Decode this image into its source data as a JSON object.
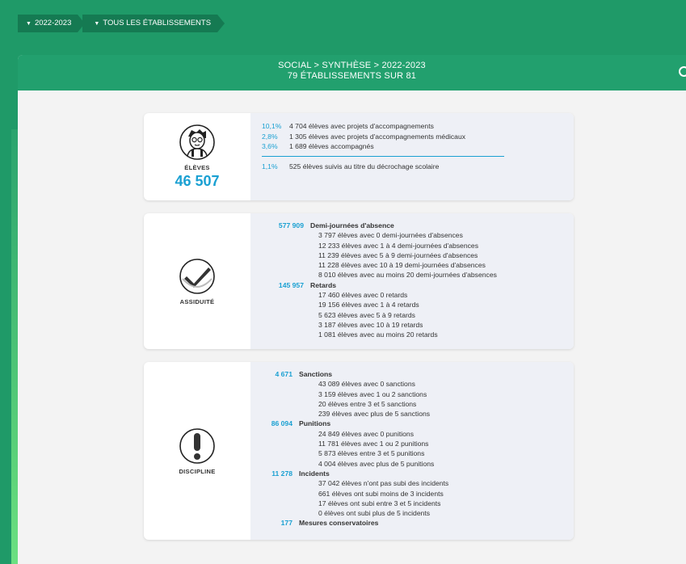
{
  "filters": {
    "year_label": "2022-2023",
    "establishments_label": "TOUS LES ÉTABLISSEMENTS"
  },
  "panel": {
    "title_line1": "SOCIAL > SYNTHÈSE > 2022-2023",
    "title_line2": "79 ÉTABLISSEMENTS SUR 81"
  },
  "eleves": {
    "label": "ÉLÈVES",
    "total": "46 507",
    "rows": [
      {
        "pct": "10,1%",
        "text": "4 704 élèves avec projets d'accompagnements"
      },
      {
        "pct": "2,8%",
        "text": "1 305 élèves avec projets d'accompagnements médicaux"
      },
      {
        "pct": "3,6%",
        "text": "1 689 élèves accompagnés"
      }
    ],
    "row_after": {
      "pct": "1,1%",
      "text": "525 élèves suivis au titre du décrochage scolaire"
    }
  },
  "assiduite": {
    "label": "ASSIDUITÉ",
    "sections": [
      {
        "num": "577 909",
        "title": "Demi-journées d'absence",
        "items": [
          "3 797 élèves avec 0 demi-journées d'absences",
          "12 233 élèves avec 1 à 4 demi-journées d'absences",
          "11 239 élèves avec 5 à 9 demi-journées d'absences",
          "11 228 élèves avec 10 à 19 demi-journées d'absences",
          "8 010 élèves avec au moins 20 demi-journées d'absences"
        ]
      },
      {
        "num": "145 957",
        "title": "Retards",
        "items": [
          "17 460 élèves avec 0 retards",
          "19 156 élèves avec 1 à 4 retards",
          "5 623 élèves avec 5 à 9 retards",
          "3 187 élèves avec 10 à 19 retards",
          "1 081 élèves avec au moins 20 retards"
        ]
      }
    ]
  },
  "discipline": {
    "label": "DISCIPLINE",
    "sections": [
      {
        "num": "4 671",
        "title": "Sanctions",
        "items": [
          "43 089 élèves avec 0 sanctions",
          "3 159 élèves avec 1 ou 2 sanctions",
          "20 élèves entre 3 et 5 sanctions",
          "239 élèves avec plus de 5 sanctions"
        ]
      },
      {
        "num": "86 094",
        "title": "Punitions",
        "items": [
          "24 849 élèves avec 0 punitions",
          "11 781 élèves avec 1 ou 2 punitions",
          "5 873 élèves entre 3 et 5 punitions",
          "4 004 élèves avec plus de 5 punitions"
        ]
      },
      {
        "num": "11 278",
        "title": "Incidents",
        "items": [
          "37 042 élèves n'ont pas subi des incidents",
          "661 élèves ont subi moins de 3 incidents",
          "17 élèves ont subi entre 3 et 5 incidents",
          "0 élèves ont subi plus de 5 incidents"
        ]
      },
      {
        "num": "177",
        "title": "Mesures conservatoires",
        "items": []
      }
    ]
  },
  "colors": {
    "brand_green": "#1f9a68",
    "accent_blue": "#1aa0d2"
  },
  "icons": [
    "chevron-down-icon",
    "student-icon",
    "check-icon",
    "exclamation-icon",
    "refresh-icon"
  ]
}
